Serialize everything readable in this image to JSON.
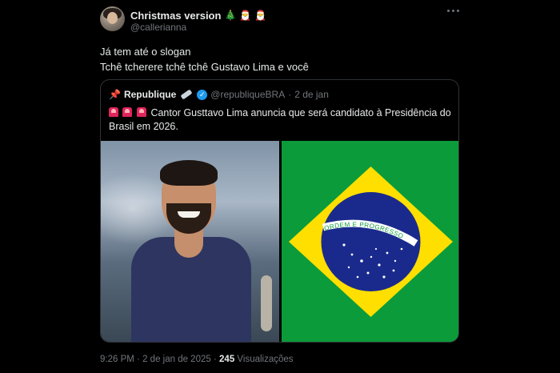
{
  "tweet": {
    "display_name": "Christmas version",
    "name_emojis": [
      "🎄",
      "🎅",
      "🎅"
    ],
    "handle": "@callerianna",
    "lines": [
      "Já tem até o slogan",
      "Tchê tcherere tchê tchê Gustavo Lima e você"
    ],
    "time": "9:26 PM",
    "date": "2 de jan de 2025",
    "views_count": "245",
    "views_label": "Visualizações",
    "separator": "·"
  },
  "quote": {
    "pin_icon": "pin-icon",
    "name": "Republique",
    "handle": "@republiqueBRA",
    "separator": "·",
    "date": "2 de jan",
    "text": "Cantor Gusttavo Lima anuncia que será candidato à Presidência do Brasil em 2026.",
    "flag_band_text": "ORDEM E PROGRESSO"
  },
  "colors": {
    "background": "#000000",
    "text": "#e7e9ea",
    "muted": "#71767b",
    "verified": "#1d9bf0",
    "flag_green": "#0b9b3a",
    "flag_yellow": "#fedf00",
    "flag_blue": "#1a2a8c"
  }
}
